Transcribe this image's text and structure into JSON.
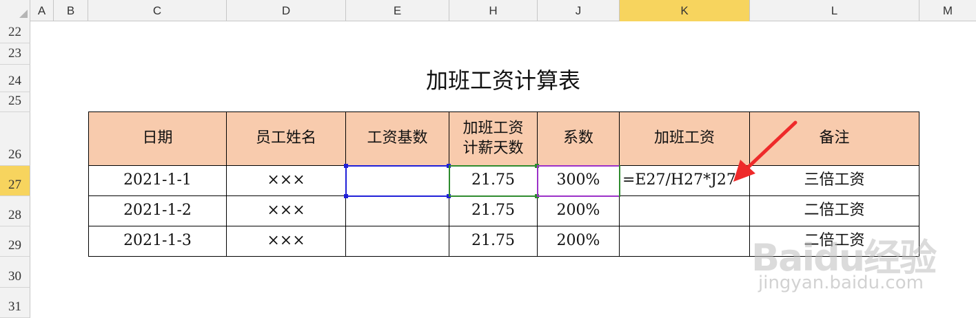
{
  "columns": [
    "A",
    "B",
    "C",
    "D",
    "E",
    "H",
    "J",
    "K",
    "L",
    "M"
  ],
  "active_column": "K",
  "rows": [
    "22",
    "23",
    "24",
    "25",
    "26",
    "27",
    "28",
    "29",
    "30",
    "31"
  ],
  "active_row": "27",
  "sheet": {
    "title": "加班工资计算表",
    "headers": {
      "date": "日期",
      "name": "员工姓名",
      "base": "工资基数",
      "days_line1": "加班工资",
      "days_line2": "计薪天数",
      "coef": "系数",
      "pay": "加班工资",
      "note": "备注"
    },
    "data_rows": [
      {
        "date": "2021-1-1",
        "name": "×××",
        "base": "",
        "days": "21.75",
        "coef": "300%",
        "pay": "=E27/H27*J27",
        "note": "三倍工资"
      },
      {
        "date": "2021-1-2",
        "name": "×××",
        "base": "",
        "days": "21.75",
        "coef": "200%",
        "pay": "",
        "note": "二倍工资"
      },
      {
        "date": "2021-1-3",
        "name": "×××",
        "base": "",
        "days": "21.75",
        "coef": "200%",
        "pay": "",
        "note": "二倍工资"
      }
    ]
  },
  "watermark": {
    "logo": "Baidu经验",
    "url": "jingyan.baidu.com"
  },
  "colors": {
    "header_fill": "#f8cbad",
    "active_header": "#f7d45e",
    "ref_blue": "#1f1fd8",
    "ref_green": "#2e8b2e",
    "ref_purple": "#9b30c8",
    "arrow": "#ee2a2a"
  }
}
